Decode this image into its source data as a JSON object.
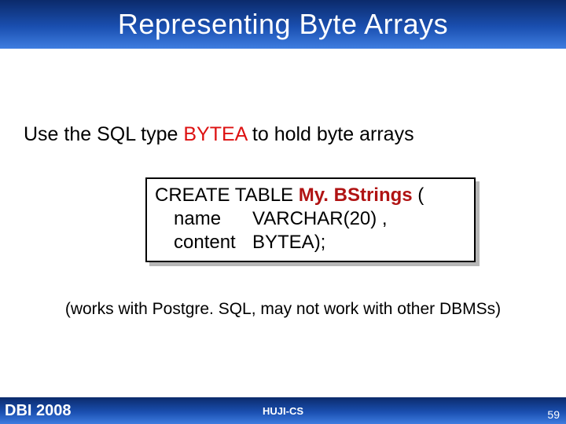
{
  "title": "Representing Byte Arrays",
  "intro": {
    "pre": "Use the SQL type ",
    "kw": "BYTEA",
    "post": " to hold byte arrays"
  },
  "code": {
    "l1_pre": "CREATE TABLE ",
    "l1_tbl": "My. BStrings",
    "l1_post": " (",
    "l2_col": "name",
    "l2_type": "VARCHAR(20) ,",
    "l3_col": "content",
    "l3_type": "BYTEA);"
  },
  "note": "(works with Postgre. SQL, may not work with other DBMSs)",
  "footer": {
    "left": "DBI 2008",
    "center": "HUJI-CS",
    "page": "59"
  }
}
